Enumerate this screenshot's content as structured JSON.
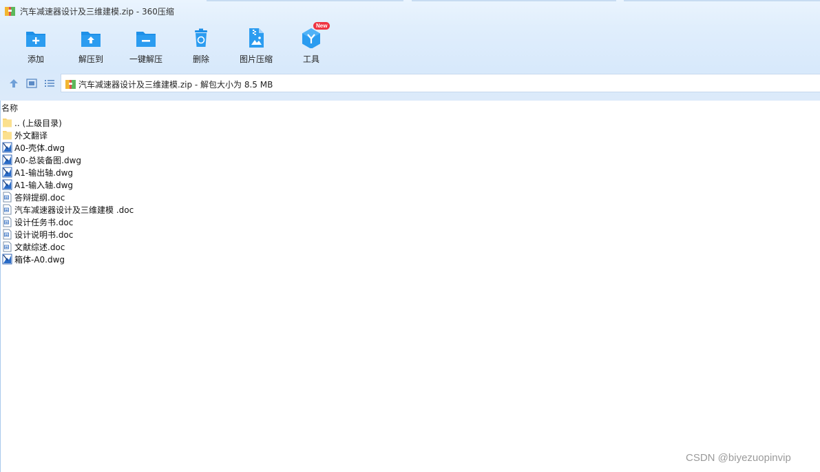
{
  "window": {
    "title": "汽车减速器设计及三维建模.zip - 360压缩"
  },
  "toolbar": {
    "items": [
      {
        "label": "添加",
        "icon": "add-folder-icon"
      },
      {
        "label": "解压到",
        "icon": "extract-to-icon"
      },
      {
        "label": "一键解压",
        "icon": "one-click-extract-icon"
      },
      {
        "label": "删除",
        "icon": "recycle-bin-icon"
      },
      {
        "label": "图片压缩",
        "icon": "image-compress-icon"
      },
      {
        "label": "工具",
        "icon": "tools-icon",
        "badge": "New"
      }
    ]
  },
  "nav": {
    "up_icon": "up-arrow-icon",
    "thumbnail_view_icon": "thumbnail-view-icon",
    "list_view_icon": "list-view-icon",
    "address_text": "汽车减速器设计及三维建模.zip - 解包大小为 8.5 MB"
  },
  "file_list": {
    "column_header": "名称",
    "files": [
      {
        "name": ".. (上级目录)",
        "type": "folder"
      },
      {
        "name": "外文翻译",
        "type": "folder"
      },
      {
        "name": "A0-壳体.dwg",
        "type": "dwg"
      },
      {
        "name": "A0-总装备图.dwg",
        "type": "dwg"
      },
      {
        "name": "A1-输出轴.dwg",
        "type": "dwg"
      },
      {
        "name": "A1-输入轴.dwg",
        "type": "dwg"
      },
      {
        "name": "答辩提纲.doc",
        "type": "doc"
      },
      {
        "name": "汽车减速器设计及三维建模 .doc",
        "type": "doc"
      },
      {
        "name": "设计任务书.doc",
        "type": "doc"
      },
      {
        "name": "设计说明书.doc",
        "type": "doc"
      },
      {
        "name": "文献综述.doc",
        "type": "doc"
      },
      {
        "name": "箱体-A0.dwg",
        "type": "dwg"
      }
    ]
  },
  "watermark": "CSDN @biyezuopinvip",
  "colors": {
    "accent": "#1e90e8",
    "folder": "#f8d476",
    "badge": "#ef3340"
  }
}
